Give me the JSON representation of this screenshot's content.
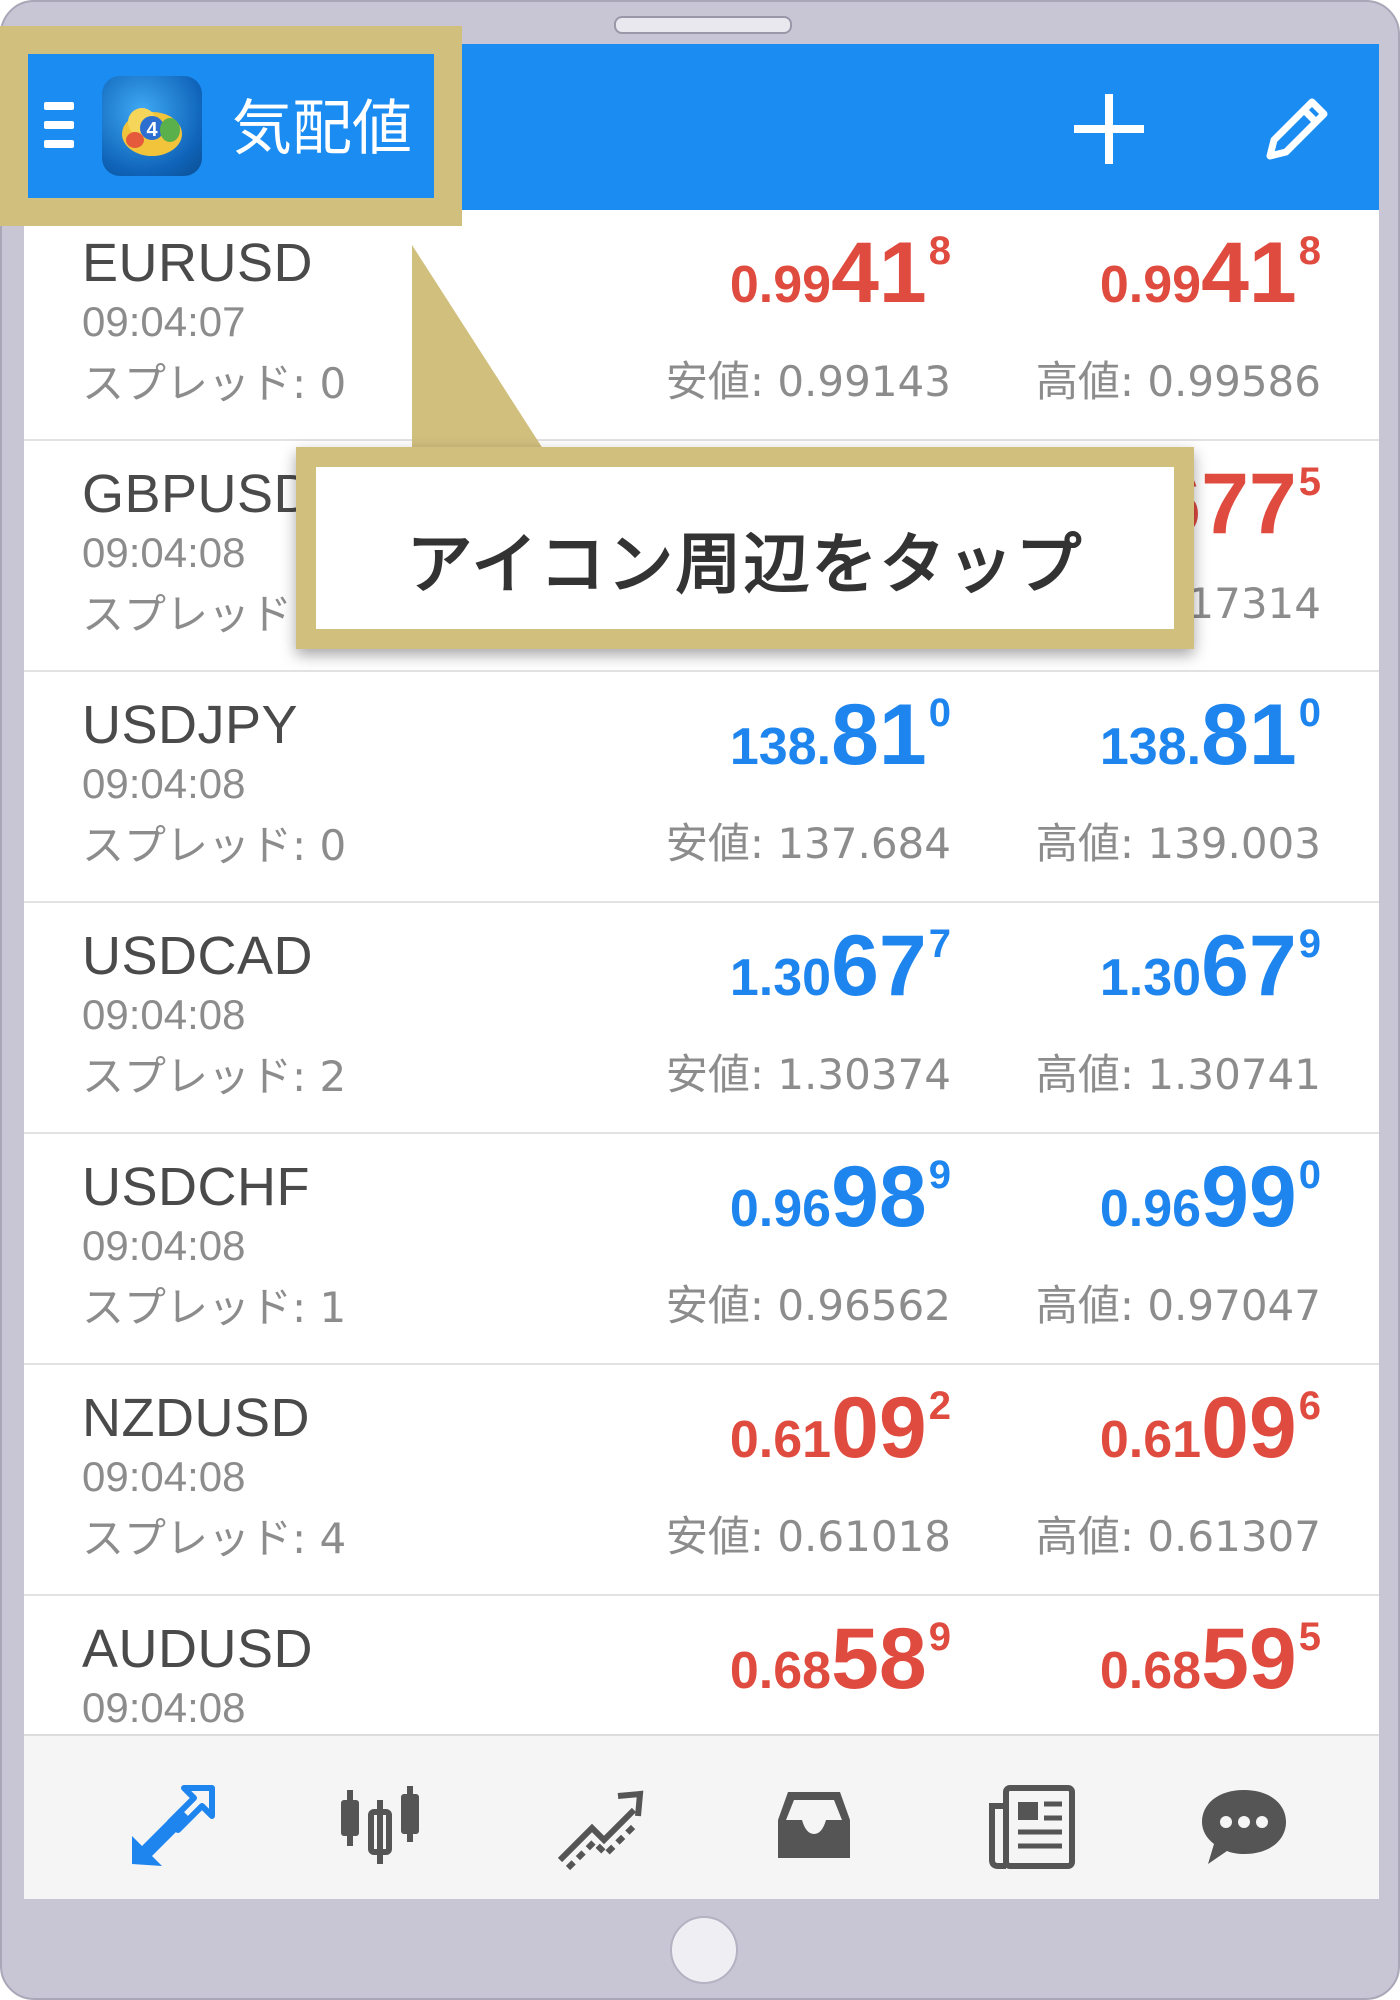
{
  "header": {
    "title": "気配値"
  },
  "quotes": [
    {
      "symbol": "EURUSD",
      "time": "09:04:07",
      "spread": "スプレッド: 0",
      "color": "red",
      "bid": {
        "pre": "0.99",
        "big": "41",
        "sup": "8"
      },
      "ask": {
        "pre": "0.99",
        "big": "41",
        "sup": "8"
      },
      "low": "安値: 0.99143",
      "high": "高値: 0.99586"
    },
    {
      "symbol": "GBPUSD",
      "time": "09:04:08",
      "spread": "スプレッド",
      "color": "red",
      "bid": {
        "pre": "",
        "big": "",
        "sup": ""
      },
      "ask": {
        "pre": "",
        "big": "677",
        "sup": "5"
      },
      "low": "",
      "high": ".17314"
    },
    {
      "symbol": "USDJPY",
      "time": "09:04:08",
      "spread": "スプレッド: 0",
      "color": "blue",
      "bid": {
        "pre": "138.",
        "big": "81",
        "sup": "0"
      },
      "ask": {
        "pre": "138.",
        "big": "81",
        "sup": "0"
      },
      "low": "安値: 137.684",
      "high": "高値: 139.003"
    },
    {
      "symbol": "USDCAD",
      "time": "09:04:08",
      "spread": "スプレッド: 2",
      "color": "blue",
      "bid": {
        "pre": "1.30",
        "big": "67",
        "sup": "7"
      },
      "ask": {
        "pre": "1.30",
        "big": "67",
        "sup": "9"
      },
      "low": "安値: 1.30374",
      "high": "高値: 1.30741"
    },
    {
      "symbol": "USDCHF",
      "time": "09:04:08",
      "spread": "スプレッド: 1",
      "color": "blue",
      "bid": {
        "pre": "0.96",
        "big": "98",
        "sup": "9"
      },
      "ask": {
        "pre": "0.96",
        "big": "99",
        "sup": "0"
      },
      "low": "安値: 0.96562",
      "high": "高値: 0.97047"
    },
    {
      "symbol": "NZDUSD",
      "time": "09:04:08",
      "spread": "スプレッド: 4",
      "color": "red",
      "bid": {
        "pre": "0.61",
        "big": "09",
        "sup": "2"
      },
      "ask": {
        "pre": "0.61",
        "big": "09",
        "sup": "6"
      },
      "low": "安値: 0.61018",
      "high": "高値: 0.61307"
    },
    {
      "symbol": "AUDUSD",
      "time": "09:04:08",
      "spread": "",
      "color": "red",
      "bid": {
        "pre": "0.68",
        "big": "58",
        "sup": "9"
      },
      "ask": {
        "pre": "0.68",
        "big": "59",
        "sup": "5"
      },
      "low": "",
      "high": ""
    }
  ],
  "callout": {
    "text": "アイコン周辺をタップ"
  },
  "nav": [
    {
      "icon": "quotes-arrows-icon",
      "active": true
    },
    {
      "icon": "candlestick-chart-icon",
      "active": false
    },
    {
      "icon": "trade-lines-icon",
      "active": false
    },
    {
      "icon": "inbox-tray-icon",
      "active": false
    },
    {
      "icon": "news-icon",
      "active": false
    },
    {
      "icon": "chat-bubble-icon",
      "active": false
    }
  ],
  "colors": {
    "accent": "#1a8cf2",
    "price_down": "#e04b3f",
    "price_up": "#1f85ee",
    "highlight": "#d1bf7e"
  }
}
